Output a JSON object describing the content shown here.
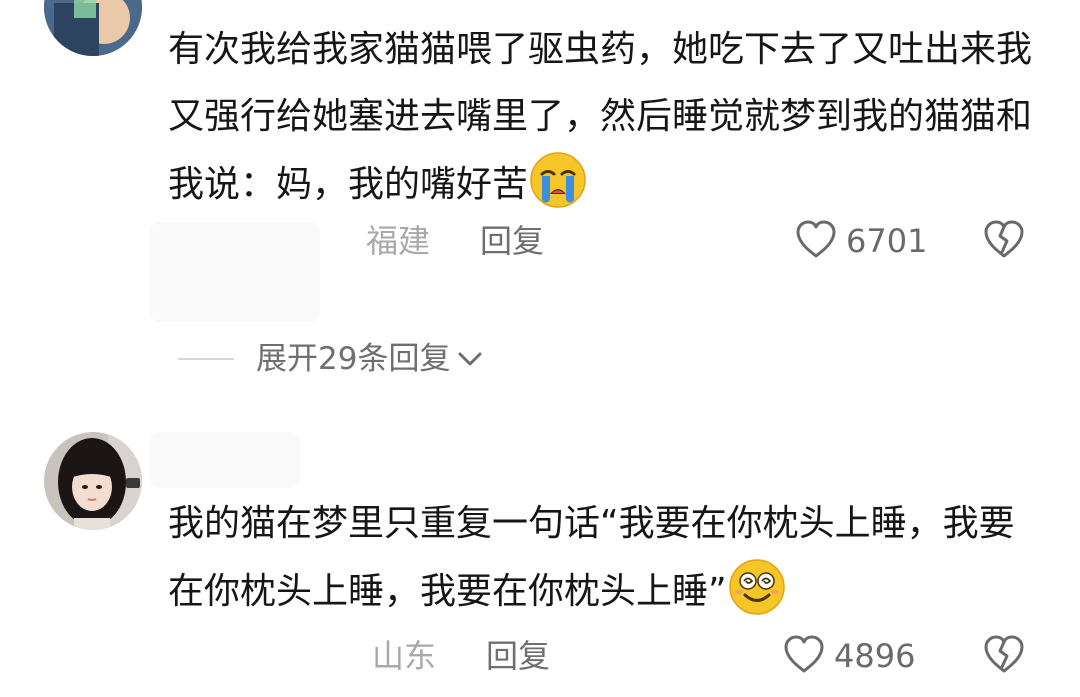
{
  "comments": [
    {
      "text": "有次我给我家猫猫喂了驱虫药，她吃下去了又吐出来我又强行给她塞进去嘴里了，然后睡觉就梦到我的猫猫和我说：妈，我的嘴好苦",
      "emoji": "crying-face-emoji",
      "location": "福建",
      "reply_label": "回复",
      "like_count": "6701",
      "expand_replies_label": "展开29条回复"
    },
    {
      "text": "我的猫在梦里只重复一句话“我要在你枕头上睡，我要在你枕头上睡，我要在你枕头上睡”",
      "emoji": "dizzy-smile-emoji",
      "location": "山东",
      "reply_label": "回复",
      "like_count": "4896"
    }
  ],
  "icons": {
    "like": "heart-outline-icon",
    "dislike": "broken-heart-icon",
    "expand": "chevron-down-icon"
  },
  "colors": {
    "text_primary": "#161616",
    "text_secondary": "#6f6f6f",
    "text_muted": "#a9a9a9",
    "emoji_yellow": "#f6c629",
    "tear_blue": "#3c8fe0"
  }
}
